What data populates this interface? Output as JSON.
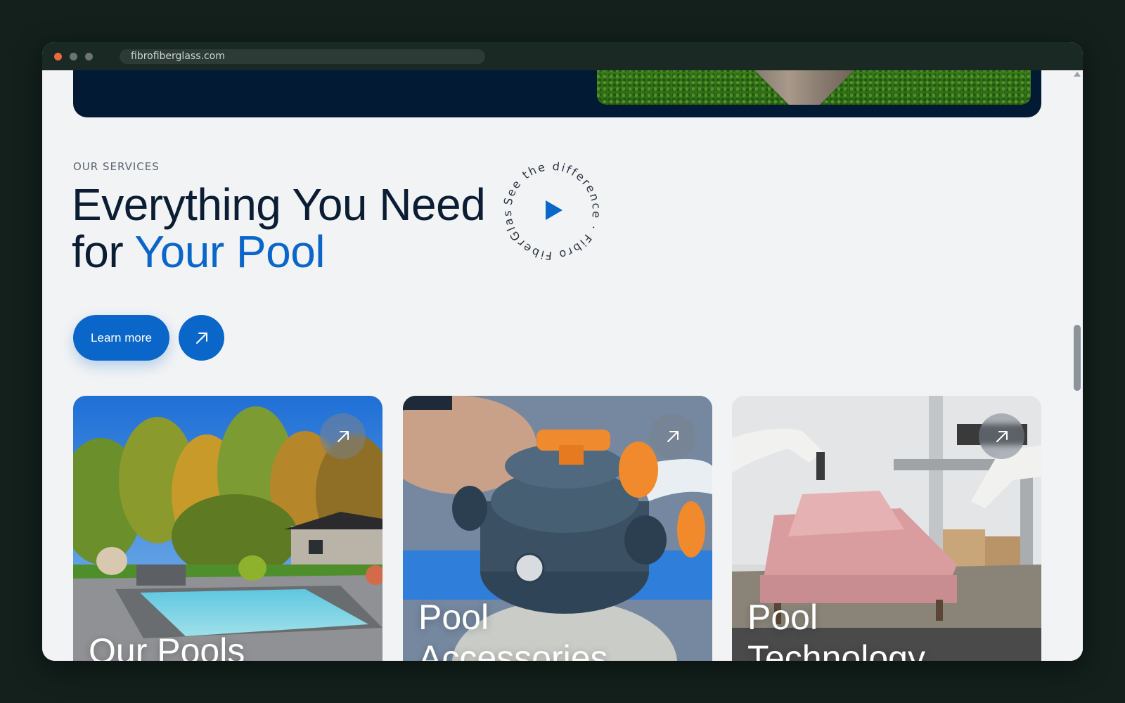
{
  "browser": {
    "url": "fibrofiberglass.com"
  },
  "services": {
    "eyebrow": "OUR SERVICES",
    "headline_line1": "Everything You Need",
    "headline_line2_prefix": "for ",
    "headline_line2_accent": "Your Pool",
    "badge_text": "See the difference · Fibro FiberGlass · ",
    "learn_more_label": "Learn more"
  },
  "cards": [
    {
      "title_line1": "Our Pools",
      "title_line2": ""
    },
    {
      "title_line1": "Pool",
      "title_line2": "Accessories"
    },
    {
      "title_line1": "Pool",
      "title_line2": "Technology"
    }
  ],
  "colors": {
    "primary_blue": "#0a66c8",
    "navy_text": "#0b1d33",
    "hero_navy": "#021a33",
    "page_bg": "#f1f3f5"
  },
  "icons": {
    "play": "play-icon",
    "arrow": "arrow-up-right-icon"
  }
}
